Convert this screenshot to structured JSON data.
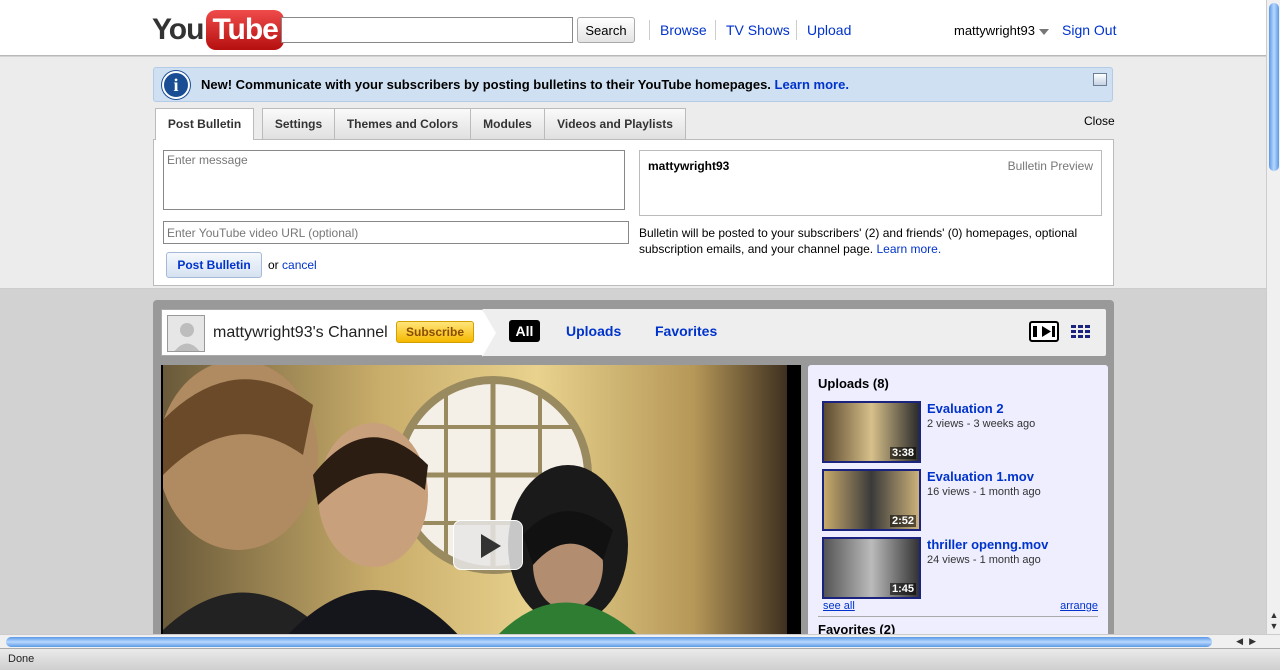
{
  "header": {
    "logo_you": "You",
    "logo_tube": "Tube",
    "search_value": "",
    "search_button": "Search",
    "nav": [
      "Browse",
      "TV Shows",
      "Upload"
    ],
    "username": "mattywright93",
    "sign_out": "Sign Out"
  },
  "info_bar": {
    "icon": "i",
    "message": "New! Communicate with your subscribers by posting bulletins to their YouTube homepages.",
    "link": "Learn more."
  },
  "edit_tabs": [
    "Post Bulletin",
    "Settings",
    "Themes and Colors",
    "Modules",
    "Videos and Playlists"
  ],
  "close_label": "Close",
  "bulletin": {
    "message_placeholder": "Enter message",
    "url_placeholder": "Enter YouTube video URL (optional)",
    "post_button": "Post Bulletin",
    "or_text": "or",
    "cancel_link": "cancel",
    "preview_user": "mattywright93",
    "preview_label": "Bulletin Preview",
    "note": "Bulletin will be posted to your subscribers' (2) and friends' (0) homepages, optional subscription emails, and your channel page.",
    "note_link": "Learn more."
  },
  "channel": {
    "title": "mattywright93's Channel",
    "subscribe": "Subscribe",
    "tabs": [
      "All",
      "Uploads",
      "Favorites"
    ],
    "uploads_heading": "Uploads (8)",
    "videos": [
      {
        "title": "Evaluation 2",
        "meta": "2 views - 3 weeks ago",
        "duration": "3:38"
      },
      {
        "title": "Evaluation 1.mov",
        "meta": "16 views - 1 month ago",
        "duration": "2:52"
      },
      {
        "title": "thriller openng.mov",
        "meta": "24 views - 1 month ago",
        "duration": "1:45"
      }
    ],
    "see_all": "see all",
    "arrange": "arrange",
    "favorites_heading": "Favorites (2)"
  },
  "status": {
    "text": "Done"
  },
  "colors": {
    "link": "#0033cc",
    "subscribe": "#f5b800",
    "logo_red": "#d21b1b"
  }
}
